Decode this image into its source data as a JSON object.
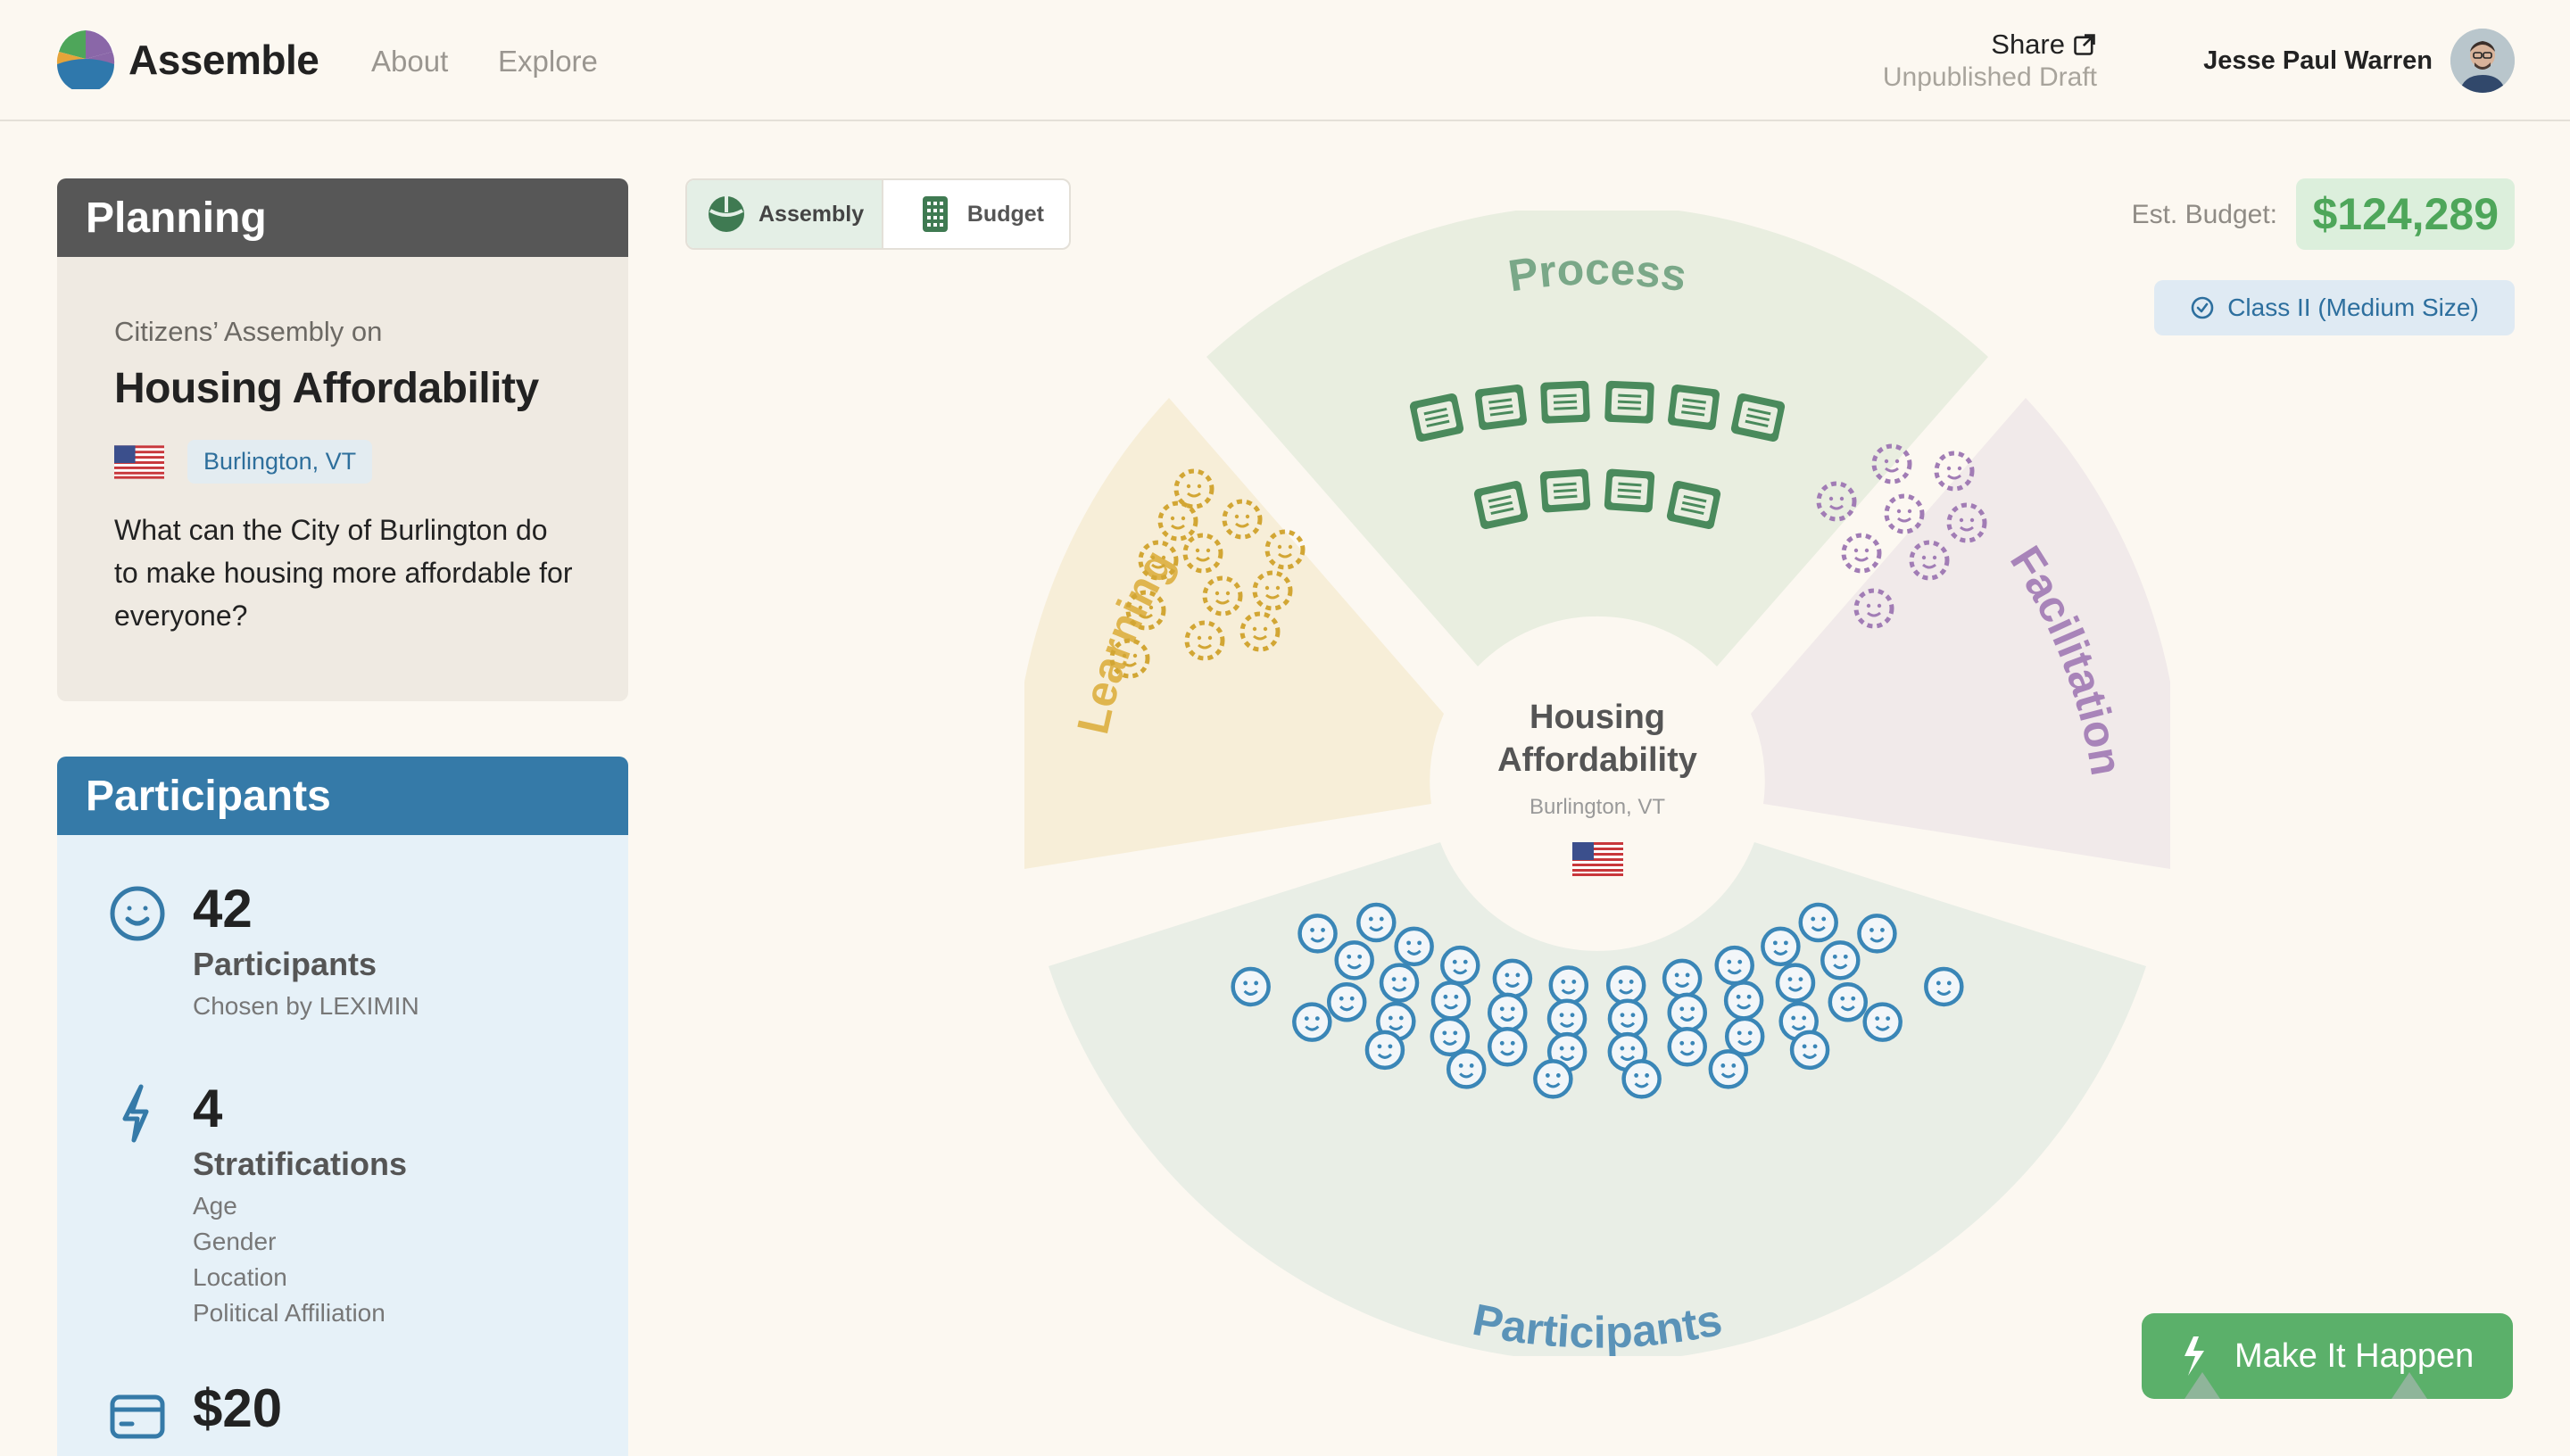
{
  "header": {
    "brand": "Assemble",
    "nav": [
      "About",
      "Explore"
    ],
    "share_label": "Share",
    "draft_status": "Unpublished Draft",
    "user_name": "Jesse Paul Warren"
  },
  "planning": {
    "heading": "Planning",
    "pre_title": "Citizens’ Assembly on",
    "title": "Housing Affordability",
    "location": "Burlington, VT",
    "question": "What can the City of Burlington do to make housing more affordable for everyone?"
  },
  "participants_panel": {
    "heading": "Participants",
    "stats": [
      {
        "value": "42",
        "label": "Participants",
        "sub": [
          "Chosen by LEXIMIN"
        ],
        "icon": "smiley-icon"
      },
      {
        "value": "4",
        "label": "Stratifications",
        "sub": [
          "Age",
          "Gender",
          "Location",
          "Political Affiliation"
        ],
        "icon": "lightning-icon"
      },
      {
        "value": "$20",
        "label": "",
        "sub": [],
        "icon": "card-icon"
      }
    ]
  },
  "view_toggle": {
    "assembly_label": "Assembly",
    "budget_label": "Budget",
    "selected": "Assembly"
  },
  "budget": {
    "label": "Est. Budget:",
    "value": "$124,289",
    "class_label": "Class II (Medium Size)"
  },
  "wheel": {
    "center_title_line1": "Housing",
    "center_title_line2": "Affordability",
    "center_location": "Burlington, VT",
    "segments": [
      {
        "name": "Process",
        "color": "#5f9c6e",
        "bg": "#e9eee0",
        "items": 10
      },
      {
        "name": "Learning",
        "color": "#d2a634",
        "bg": "#f7eed8",
        "items": 12
      },
      {
        "name": "Facilitation",
        "color": "#a17cb5",
        "bg": "#f1eaea",
        "items": 8
      },
      {
        "name": "Participants",
        "color": "#5b93b8",
        "bg": "#e9eee6",
        "items": 42
      }
    ]
  },
  "cta_label": "Make It Happen",
  "colors": {
    "accent_green": "#5bb06a",
    "participants_blue": "#357aa8",
    "planning_gray": "#575757"
  }
}
